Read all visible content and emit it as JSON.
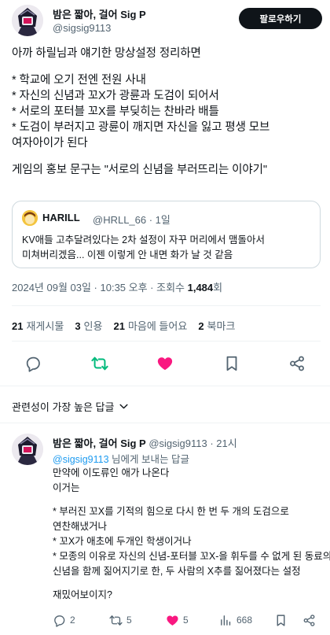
{
  "tweet": {
    "author_name": "밤은 짧아, 걸어 Sig P",
    "author_handle": "@sigsig9113",
    "follow_label": "팔로우하기",
    "text_lines": [
      "아까 하릴님과 얘기한 망상설정 정리하면",
      "",
      "* 학교에 오기 전엔 전원 사내",
      "* 자신의 신념과 꼬X가 광륜과 도검이 되어서",
      "* 서로의 포터블 꼬X를 부딪히는 찬바라 배틀",
      "* 도검이 부러지고 광륜이 깨지면 자신을 잃고 평생 모브",
      "여자아이가 된다",
      "",
      "게임의 홍보 문구는 \"서로의 신념을 부러뜨리는 이야기\""
    ],
    "quote": {
      "name": "HARILL",
      "handle_time": "@HRLL_66 · 1일",
      "text_lines": [
        "KV애들 고추달려있다는 2차 설정이 자꾸 머리에서 맴돌아서",
        "미쳐버리겠음... 이젠 이렇게 안 내면 화가 날 것 같음"
      ]
    },
    "meta_prefix": "2024년 09월 03일 · 10:35 오후 · 조회수 ",
    "views": "1,484",
    "views_suffix": "회",
    "stats": {
      "retweets_count": "21",
      "retweets_label": "재게시물",
      "quotes_count": "3",
      "quotes_label": "인용",
      "likes_count": "21",
      "likes_label": "마음에 들어요",
      "bookmarks_count": "2",
      "bookmarks_label": "북마크"
    }
  },
  "sort_label": "관련성이 가장 높은 답글",
  "reply": {
    "author_name": "밤은 짧아, 걸어 Sig P",
    "handle_time": "@sigsig9113 · 21시",
    "reply_to_mention": "@sigsig9113",
    "reply_to_suffix": " 님에게 보내는 답글",
    "text_lines": [
      "만약에 이도류인 애가 나온다",
      "이거는",
      "",
      "* 부러진 꼬X를 기적의 힘으로 다시 한 번 두 개의 도검으로",
      "연찬해냈거나",
      "* 꼬X가 애초에 두개인 학생이거나",
      "* 모종의 이유로 자신의 신념-포터블 꼬X-을 휘두를 수 없게 된 동료의",
      "신념을 함께 짊어지기로 한, 두 사람의 X추를 짊어졌다는 설정",
      "",
      "재밌어보이지?"
    ],
    "actions": {
      "replies": "2",
      "retweets": "5",
      "likes": "5",
      "views": "668"
    }
  },
  "colors": {
    "text": "#0f1419",
    "secondary": "#536471",
    "link": "#1d9bf0",
    "like": "#f91880",
    "retweet": "#00ba7c",
    "border": "#cfd9de"
  },
  "icons": [
    "reply-icon",
    "retweet-icon",
    "heart-icon",
    "bookmark-icon",
    "share-icon",
    "chevron-down-icon",
    "views-icon"
  ]
}
